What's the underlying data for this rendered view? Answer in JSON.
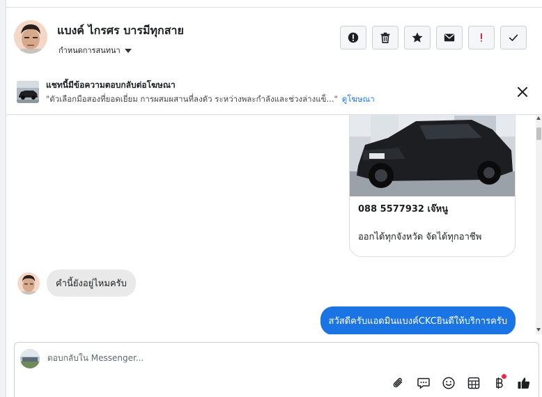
{
  "header": {
    "name": "แบงค์ ไกรศร บารมีทุกสาย",
    "assign_label": "กำหนดการสนทนา",
    "actions": [
      "exclamation-circle-icon",
      "trash-icon",
      "star-icon",
      "envelope-icon",
      "exclamation-icon",
      "checkmark-icon"
    ]
  },
  "banner": {
    "title": "แชทนี้มีข้อความตอบกลับต่อโฆษณา",
    "text": "\"ตัวเลือกมือสองที่ยอดเยี่ยม การผสมผสานที่ลงตัว ระหว่างพละกำลังและช่วงล่างแข็...\"",
    "link": "ดูโฆษณา"
  },
  "card": {
    "phone": "088 5577932 เจ๊หนู",
    "desc": "ออกได้ทุกจังหวัด จัดได้ทุกอาชีพ"
  },
  "messages": {
    "incoming": "คำนี้ยังอยู่ไหมครับ",
    "outgoing": "สวัสดีครับแอดมินแบงค์CKCยินดีให้บริการครับ"
  },
  "composer": {
    "placeholder": "ตอบกลับใน Messenger...",
    "tools": [
      "paperclip-icon",
      "speech-bubble-icon",
      "emoji-icon",
      "calculator-icon",
      "baht-icon",
      "thumbs-up-icon"
    ]
  },
  "colors": {
    "accent": "#1b74e4",
    "link": "#1877f2",
    "danger": "#e41e3f",
    "notification": "#f02849"
  }
}
